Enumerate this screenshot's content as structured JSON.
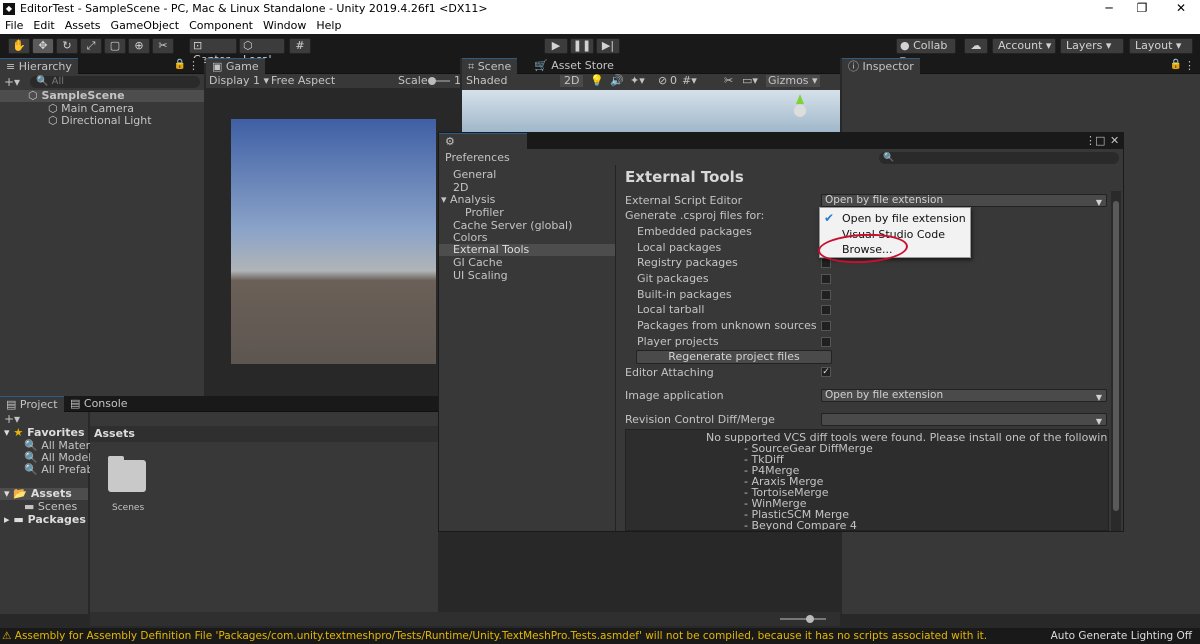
{
  "window": {
    "title": "EditorTest - SampleScene - PC, Mac & Linux Standalone - Unity 2019.4.26f1 <DX11>",
    "app_icon": "unity-icon"
  },
  "menu": [
    "File",
    "Edit",
    "Assets",
    "GameObject",
    "Component",
    "Window",
    "Help"
  ],
  "toolbar": {
    "pivot_label": "Center",
    "space_label": "Local",
    "collab_label": "Collab",
    "account_label": "Account",
    "layers_label": "Layers",
    "layout_label": "Layout"
  },
  "hierarchy": {
    "tab": "Hierarchy",
    "search_placeholder": "All",
    "scene": "SampleScene",
    "items": [
      "Main Camera",
      "Directional Light"
    ]
  },
  "game": {
    "tab": "Game",
    "display": "Display 1",
    "aspect": "Free Aspect",
    "scale_label": "Scale",
    "scale_value": "1"
  },
  "scene": {
    "tab": "Scene",
    "asset_store_tab": "Asset Store",
    "shading": "Shaded",
    "mode_2d": "2D",
    "gizmo_count": "0",
    "gizmos": "Gizmos"
  },
  "inspector": {
    "tab": "Inspector"
  },
  "project": {
    "tab": "Project",
    "console_tab": "Console",
    "favorites_label": "Favorites",
    "favorites": [
      "All Materials",
      "All Models",
      "All Prefabs"
    ],
    "assets_label": "Assets",
    "asset_children": [
      "Scenes"
    ],
    "packages_label": "Packages",
    "breadcrumb": "Assets",
    "files": [
      "Scenes"
    ]
  },
  "preferences": {
    "title": "Preferences",
    "nav": [
      "General",
      "2D",
      "Analysis",
      "Profiler",
      "Cache Server (global)",
      "Colors",
      "External Tools",
      "GI Cache",
      "UI Scaling"
    ],
    "selected_nav": "External Tools",
    "heading": "External Tools",
    "script_editor_label": "External Script Editor",
    "script_editor_value": "Open by file extension",
    "csproj_label": "Generate .csproj files for:",
    "csproj_options": [
      {
        "label": "Embedded packages",
        "checked": false
      },
      {
        "label": "Local packages",
        "checked": false
      },
      {
        "label": "Registry packages",
        "checked": false
      },
      {
        "label": "Git packages",
        "checked": false
      },
      {
        "label": "Built-in packages",
        "checked": false
      },
      {
        "label": "Local tarball",
        "checked": false
      },
      {
        "label": "Packages from unknown sources",
        "checked": false
      },
      {
        "label": "Player projects",
        "checked": false
      }
    ],
    "regenerate_button": "Regenerate project files",
    "editor_attaching_label": "Editor Attaching",
    "editor_attaching_checked": true,
    "image_app_label": "Image application",
    "image_app_value": "Open by file extension",
    "revision_label": "Revision Control Diff/Merge",
    "vcs_message": "No supported VCS diff tools were found. Please install one of the following tools:",
    "vcs_tools": [
      "- SourceGear DiffMerge",
      "- TkDiff",
      "- P4Merge",
      "- Araxis Merge",
      "- TortoiseMerge",
      "- WinMerge",
      "- PlasticSCM Merge",
      "- Beyond Compare 4"
    ],
    "dropdown_options": [
      {
        "label": "Open by file extension",
        "selected": true
      },
      {
        "label": "Visual Studio Code",
        "selected": false
      },
      {
        "label": "Browse...",
        "selected": false
      }
    ],
    "highlight_color": "#c8102e"
  },
  "status": {
    "message": "Assembly for Assembly Definition File 'Packages/com.unity.textmeshpro/Tests/Runtime/Unity.TextMeshPro.Tests.asmdef' will not be compiled, because it has no scripts associated with it.",
    "right": "Auto Generate Lighting Off"
  }
}
